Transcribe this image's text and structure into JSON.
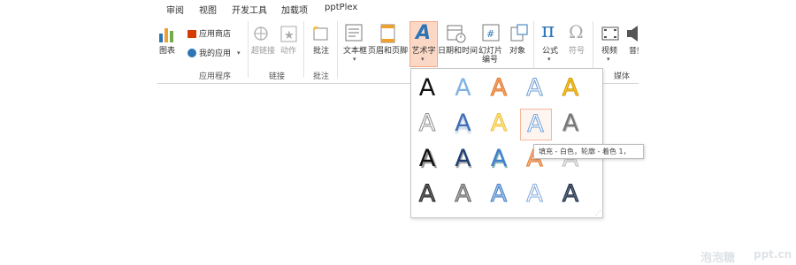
{
  "tabs": [
    "审阅",
    "视图",
    "开发工具",
    "加载项",
    "pptPlex"
  ],
  "ribbon": {
    "chart": "图表",
    "store": "应用商店",
    "my_apps": "我的应用",
    "group_apps": "应用程序",
    "hyperlink": "超链接",
    "action": "动作",
    "group_links": "链接",
    "comment": "批注",
    "group_comments": "批注",
    "textbox": "文本框",
    "header_footer": "页眉和页脚",
    "wordart": "艺术字",
    "datetime": "日期和时间",
    "slide_number_1": "幻灯片",
    "slide_number_2": "编号",
    "object": "对象",
    "equation": "公式",
    "symbol": "符号",
    "video": "视频",
    "audio": "音频",
    "group_media": "媒体"
  },
  "wordart_glyph": "A",
  "tooltip": "填充 - 白色，轮廓 - 着色 1，",
  "watermark": {
    "left": "泡泡糖",
    "right": "ppt.cn"
  }
}
